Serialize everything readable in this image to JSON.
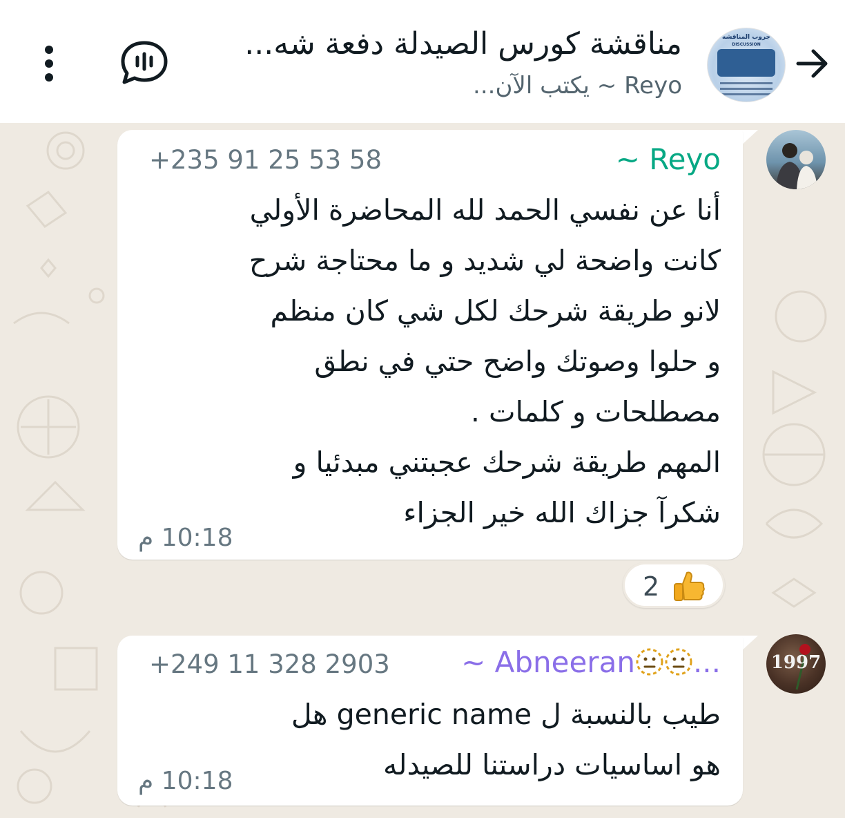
{
  "header": {
    "title": "مناقشة كورس الصيدلة دفعة شه...",
    "subtitle": "Reyo ~ يكتب الآن...",
    "avatar_text_top": "جروب المناقشه",
    "avatar_text_sub": "DISCUSSION",
    "icons": {
      "back": "arrow-right-icon",
      "voice_call": "voice-chat-icon",
      "menu": "more-vertical-icon"
    }
  },
  "messages": [
    {
      "sender_name": "~ Reyo",
      "sender_phone": "+235 91 25 53 58",
      "text": "أنا عن نفسي الحمد لله  المحاضرة الأولي\nكانت واضحة لي شديد و ما محتاجة شرح\nلانو طريقة شرحك لكل شي كان منظم\nو حلوا  وصوتك واضح حتي في نطق\nمصطلحات و كلمات .\nالمهم طريقة شرحك عجبتني مبدئيا  و\nشكرآ جزاك الله خير الجزاء",
      "time": "10:18 م",
      "reaction": {
        "emoji": "thumbs-up-icon",
        "count": "2"
      }
    },
    {
      "sender_name": "~ Abneeran",
      "sender_name_suffix": "...",
      "sender_name_emoji": "neutral-face-icon",
      "sender_phone": "+249 11 328 2903",
      "sender_avatar_text": "1997",
      "text": "طيب بالنسبة ل generic name هل\nهو اساسيات دراستنا للصيدله",
      "time": "10:18 م"
    }
  ],
  "colors": {
    "wallpaper": "#efeae2",
    "reyo_name": "#06a884",
    "abneeran_name": "#8a6ee8",
    "meta_text": "#667781"
  }
}
